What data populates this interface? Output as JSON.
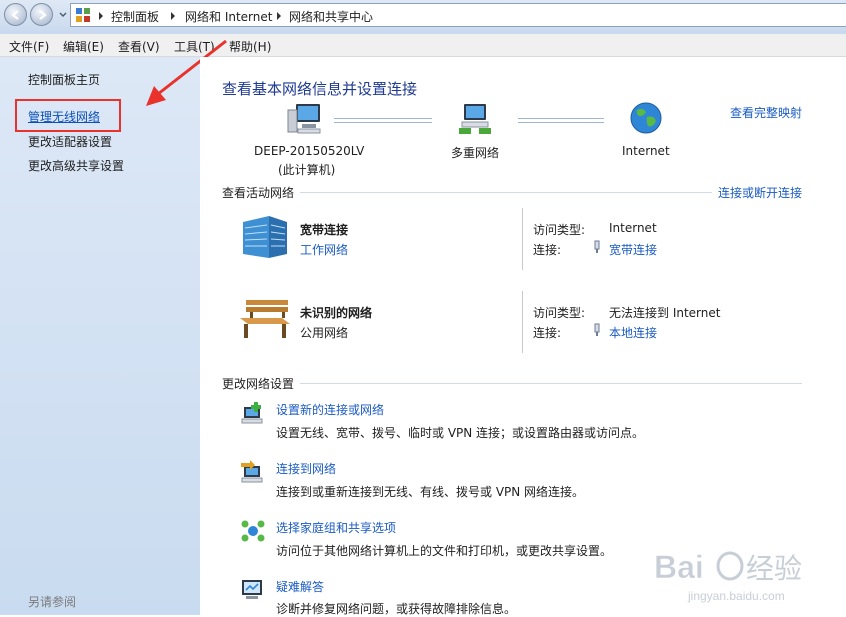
{
  "addressbar": {
    "crumbs": [
      "控制面板",
      "网络和 Internet",
      "网络和共享中心"
    ]
  },
  "menu": {
    "items": [
      "文件(F)",
      "编辑(E)",
      "查看(V)",
      "工具(T)",
      "帮助(H)"
    ]
  },
  "sidebar": {
    "home": "控制面板主页",
    "links": [
      "管理无线网络",
      "更改适配器设置",
      "更改高级共享设置"
    ],
    "see_also": "另请参阅"
  },
  "main": {
    "title": "查看基本网络信息并设置连接",
    "full_map_link": "查看完整映射",
    "map": {
      "computer_name": "DEEP-20150520LV",
      "computer_note": "(此计算机)",
      "multi_network": "多重网络",
      "internet": "Internet"
    },
    "active_section": "查看活动网络",
    "connect_disconnect_link": "连接或断开连接",
    "networks": [
      {
        "name": "宽带连接",
        "type": "工作网络",
        "access_label": "访问类型:",
        "access_value": "Internet",
        "conn_label": "连接:",
        "conn_value": "宽带连接"
      },
      {
        "name": "未识别的网络",
        "type": "公用网络",
        "access_label": "访问类型:",
        "access_value": "无法连接到 Internet",
        "conn_label": "连接:",
        "conn_value": "本地连接"
      }
    ],
    "change_section": "更改网络设置",
    "tasks": [
      {
        "title": "设置新的连接或网络",
        "desc": "设置无线、宽带、拨号、临时或 VPN 连接；或设置路由器或访问点。"
      },
      {
        "title": "连接到网络",
        "desc": "连接到或重新连接到无线、有线、拨号或 VPN 网络连接。"
      },
      {
        "title": "选择家庭组和共享选项",
        "desc": "访问位于其他网络计算机上的文件和打印机，或更改共享设置。"
      },
      {
        "title": "疑难解答",
        "desc": "诊断并修复网络问题，或获得故障排除信息。"
      }
    ]
  },
  "watermark": {
    "text": "Baidu经验",
    "sub": "jingyan.baidu.com"
  },
  "colors": {
    "link": "#1a5bc4",
    "title": "#1f3a93",
    "highlight": "#e8322b",
    "sidebar": "#d3e2f3"
  }
}
